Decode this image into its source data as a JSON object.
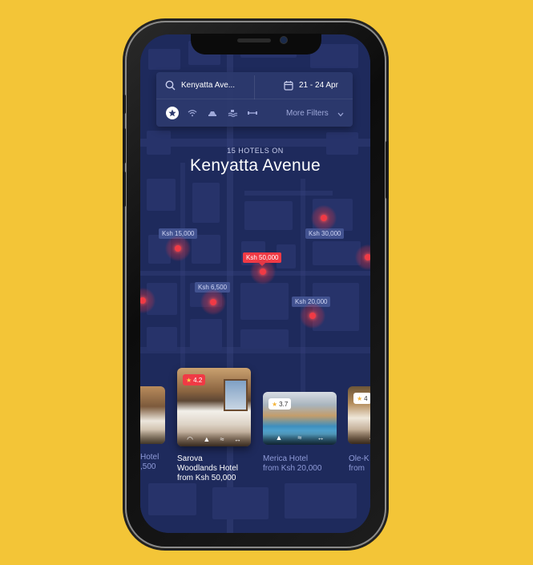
{
  "search": {
    "location": "Kenyatta Ave...",
    "dates": "21 - 24 Apr",
    "more_filters": "More Filters",
    "filter_icons": [
      "star-icon",
      "wifi-icon",
      "parking-icon",
      "pool-icon",
      "gym-icon"
    ]
  },
  "header": {
    "subtitle": "15 HOTELS ON",
    "title": "Kenyatta Avenue"
  },
  "map_markers": [
    {
      "label": "Ksh 15,000",
      "active": false
    },
    {
      "label": "Ksh 30,000",
      "active": false
    },
    {
      "label": "Ksh 50,000",
      "active": true
    },
    {
      "label": "Ksh 6,500",
      "active": false
    },
    {
      "label": "Ksh 20,000",
      "active": false
    }
  ],
  "hotels": [
    {
      "name_partial": "Hotel",
      "price_partial": ",500"
    },
    {
      "rating": "4.2",
      "name_line1": "Sarova",
      "name_line2": "Woodlands Hotel",
      "price": "from Ksh 50,000",
      "selected": true
    },
    {
      "rating": "3.7",
      "name": "Merica Hotel",
      "price": "from Ksh 20,000"
    },
    {
      "rating": "4",
      "name_partial": "Ole-K",
      "price_partial": "from"
    }
  ],
  "colors": {
    "background": "#F3C537",
    "map": "#1E2A5C",
    "accent_red": "#F03A45",
    "muted_text": "#8F9BD8"
  }
}
